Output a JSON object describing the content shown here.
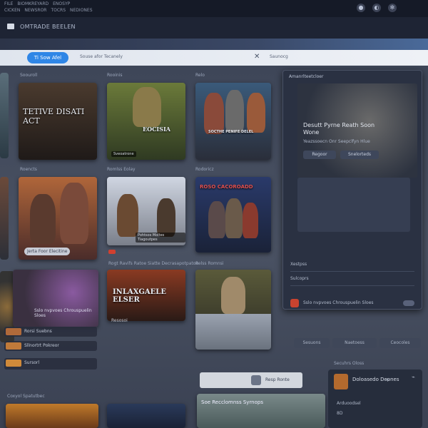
{
  "window": {
    "menu_row1": [
      "FILE",
      "BIOMKREYARD",
      "ENOSYP"
    ],
    "menu_row2": [
      "CICKEN",
      "NEWSROR",
      "TOCRS",
      "NEDIONES"
    ],
    "top_icons": [
      "bell-icon",
      "user-icon",
      "settings-icon"
    ]
  },
  "header": {
    "app_title": "OMTRADE BEELEN"
  },
  "search": {
    "button_label": "Ti Sow Afel",
    "filter_text": "Souse afor Tecanely",
    "sort_label": "Saunocg"
  },
  "sections": {
    "row1_labels": [
      "Soouroll",
      "Rooinis",
      "Relo"
    ],
    "row2_labels": [
      "Roencts",
      "Romlss Eolay",
      "Rodoricz"
    ],
    "row3_labels": [
      "Rogt Ravifs Ratoe Siatte Decrasapotpatoe",
      "Relss Romnsi"
    ]
  },
  "cards": {
    "c1": {
      "title": "TETIVE DISATI ACT"
    },
    "c2": {
      "title": "EOCISIA",
      "caption": "Sveoatrone"
    },
    "c3": {
      "title": "SOCTHE PENIFE DELEL"
    },
    "c4": {
      "caption": "Jerta Foor Elecitine"
    },
    "c5": {
      "title": "ROSO CACOROADD",
      "caption": "Pohtsos Moltes Tiagoutpes"
    },
    "c7": {
      "title": "INLAXGAELE ELSER",
      "caption": "Resosoi"
    }
  },
  "panel": {
    "header": "Amanrlteetcloer",
    "title": "Desutt Pyrne Reath Soon Wone",
    "subtitle": "Yeazssoecn Onr Seepclfyn Hlue",
    "btn1": "Regoor",
    "btn2": "Snelorteds",
    "row1": "Xestpss",
    "row2": "Sulcoprs",
    "promo": "Sslo nvpvoes Chrouspuelin Sloes"
  },
  "tabs": [
    "Sesuons",
    "Naetoess",
    "Ceocoles"
  ],
  "list": [
    {
      "label": "Rorsi Suebns"
    },
    {
      "label": "Sllnortrt Pokreor"
    },
    {
      "label": "Sursorl"
    }
  ],
  "bottom": {
    "left_label": "Coxyol Spatutbec",
    "shelf_label": "Soe Recclomnss Syrnops",
    "chip_text": "Resp Ronte"
  },
  "friends": {
    "header": "Secuhrs Oloss",
    "name": "Doloasedo Deones",
    "sub": "Arduoodsel",
    "count": "8D"
  }
}
